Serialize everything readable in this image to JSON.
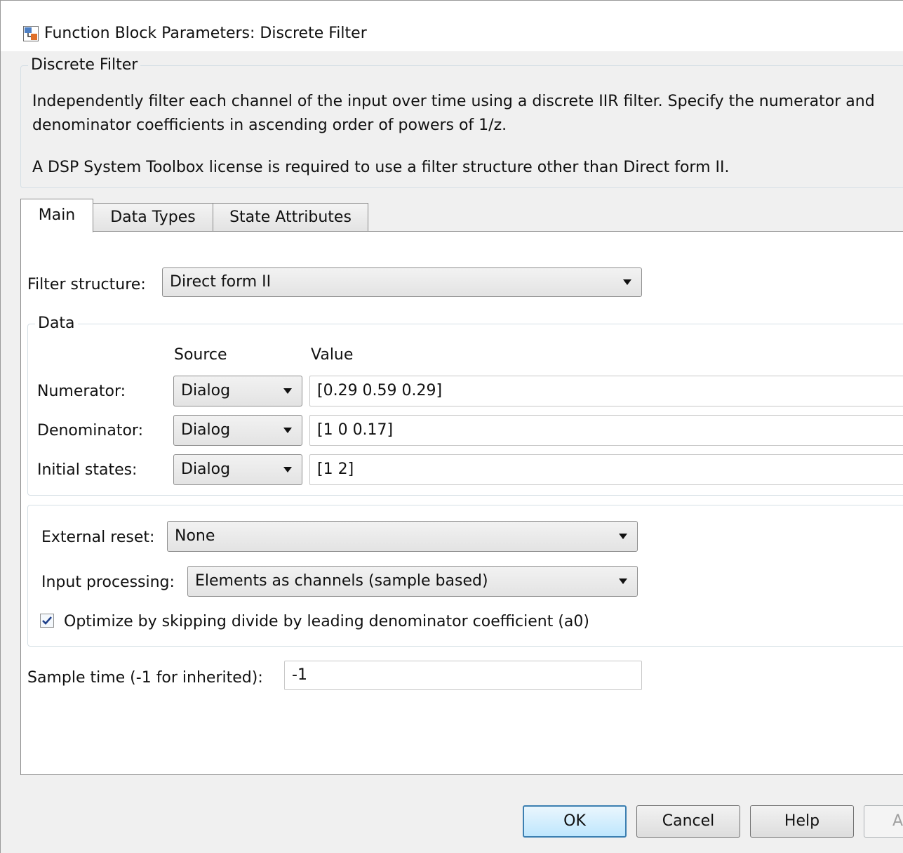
{
  "window": {
    "title": "Function Block Parameters: Discrete Filter"
  },
  "description": {
    "legend": "Discrete Filter",
    "line1": "Independently filter each channel of the input over time using a discrete IIR filter. Specify the numerator and",
    "line2": "denominator coefficients in ascending order of powers of 1/z.",
    "line3": "A DSP System Toolbox license is required to use a filter structure other than Direct form II."
  },
  "tabs": [
    {
      "label": "Main",
      "active": true
    },
    {
      "label": "Data Types",
      "active": false
    },
    {
      "label": "State Attributes",
      "active": false
    }
  ],
  "main": {
    "filter_structure": {
      "label": "Filter structure:",
      "value": "Direct form II"
    },
    "data_group": {
      "legend": "Data",
      "source_header": "Source",
      "value_header": "Value",
      "rows": [
        {
          "label": "Numerator:",
          "source": "Dialog",
          "value": "[0.29 0.59 0.29]"
        },
        {
          "label": "Denominator:",
          "source": "Dialog",
          "value": "[1 0 0.17]"
        },
        {
          "label": "Initial states:",
          "source": "Dialog",
          "value": "[1 2]"
        }
      ]
    },
    "external_reset": {
      "label": "External reset:",
      "value": "None"
    },
    "input_processing": {
      "label": "Input processing:",
      "value": "Elements as channels (sample based)"
    },
    "optimize_checkbox": {
      "label": "Optimize by skipping divide by leading denominator coefficient (a0)",
      "checked": true
    },
    "sample_time": {
      "label": "Sample time (-1 for inherited):",
      "value": "-1"
    }
  },
  "buttons": {
    "ok": "OK",
    "cancel": "Cancel",
    "help": "Help",
    "apply": "A"
  },
  "colors": {
    "accent": "#3c7fb1",
    "checkmark": "#1e3f8a"
  }
}
